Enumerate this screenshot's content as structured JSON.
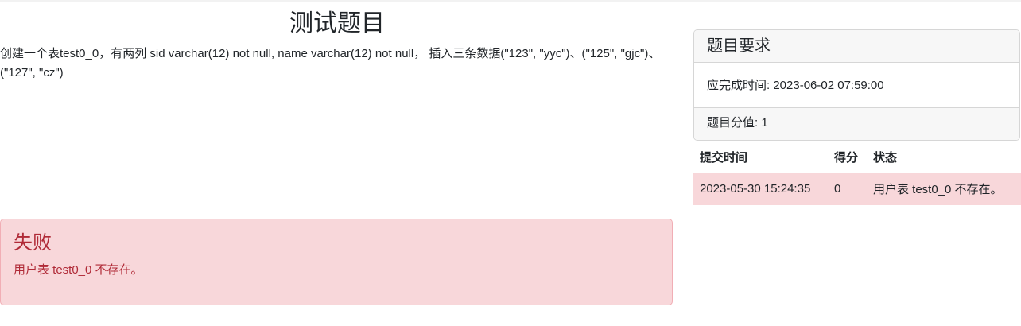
{
  "page": {
    "title": "测试题目",
    "description": "创建一个表test0_0，有两列 sid varchar(12) not null, name varchar(12) not null， 插入三条数据(\"123\", \"yyc\")、(\"125\", \"gjc\")、(\"127\", \"cz\")"
  },
  "result_alert": {
    "title": "失败",
    "message": "用户表 test0_0 不存在。",
    "color": "#b02a37",
    "background": "#f8d7da"
  },
  "requirements": {
    "header": "题目要求",
    "deadline": "应完成时间: 2023-06-02 07:59:00",
    "score": "题目分值: 1"
  },
  "submissions": {
    "columns": [
      "提交时间",
      "得分",
      "状态"
    ],
    "rows": [
      {
        "time": "2023-05-30 15:24:35",
        "score": "0",
        "status": "用户表 test0_0 不存在。"
      }
    ]
  }
}
